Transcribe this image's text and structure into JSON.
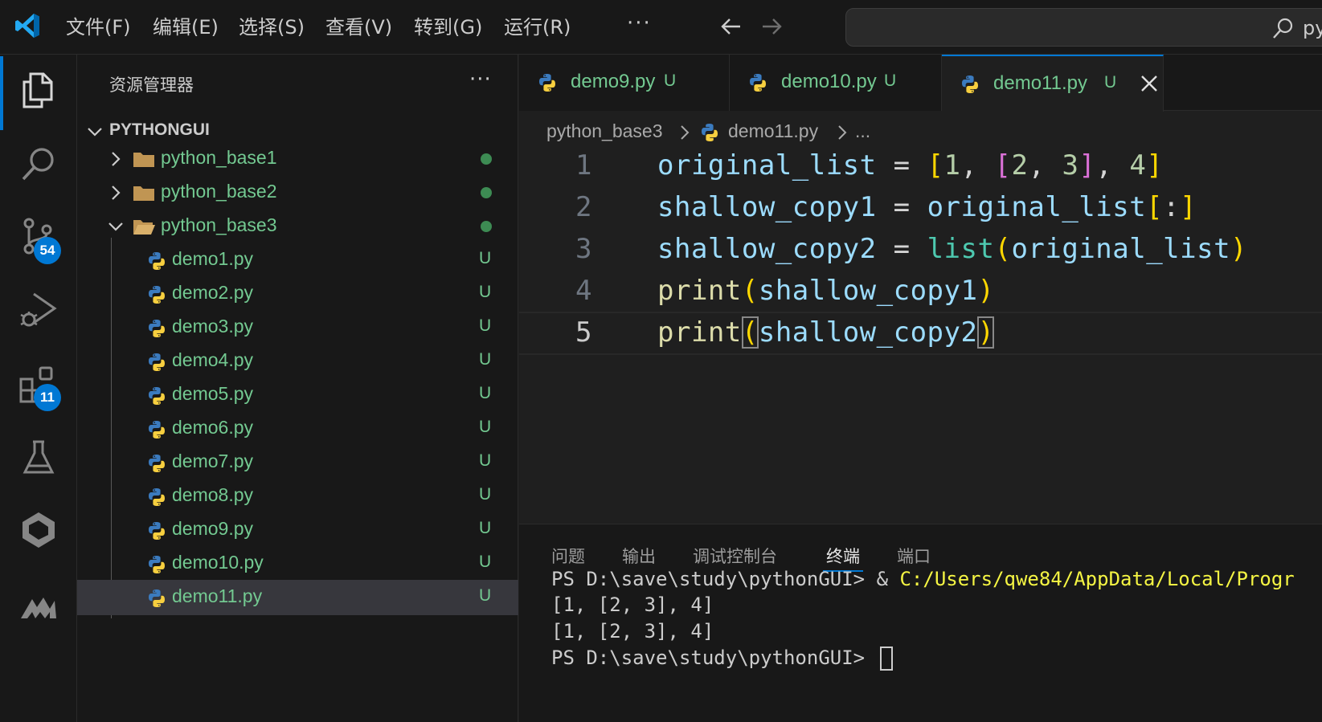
{
  "menu": {
    "items": [
      "文件(F)",
      "编辑(E)",
      "选择(S)",
      "查看(V)",
      "转到(G)",
      "运行(R)"
    ],
    "more": "···"
  },
  "search": {
    "text": "py"
  },
  "activity": {
    "scm_badge": "54",
    "extensions_badge": "11"
  },
  "sidebar": {
    "title": "资源管理器",
    "more": "···",
    "root": "PYTHONGUI",
    "folders": [
      "python_base1",
      "python_base2",
      "python_base3"
    ],
    "files": [
      {
        "name": "demo1.py",
        "status": "U"
      },
      {
        "name": "demo2.py",
        "status": "U"
      },
      {
        "name": "demo3.py",
        "status": "U"
      },
      {
        "name": "demo4.py",
        "status": "U"
      },
      {
        "name": "demo5.py",
        "status": "U"
      },
      {
        "name": "demo6.py",
        "status": "U"
      },
      {
        "name": "demo7.py",
        "status": "U"
      },
      {
        "name": "demo8.py",
        "status": "U"
      },
      {
        "name": "demo9.py",
        "status": "U"
      },
      {
        "name": "demo10.py",
        "status": "U"
      },
      {
        "name": "demo11.py",
        "status": "U"
      }
    ]
  },
  "tabs": [
    {
      "label": "demo9.py",
      "status": "U"
    },
    {
      "label": "demo10.py",
      "status": "U"
    },
    {
      "label": "demo11.py",
      "status": "U"
    }
  ],
  "breadcrumb": {
    "folder": "python_base3",
    "file": "demo11.py",
    "more": "..."
  },
  "code": {
    "line_numbers": [
      "1",
      "2",
      "3",
      "4",
      "5"
    ],
    "lines": [
      "original_list = [1, [2, 3], 4]",
      "shallow_copy1 = original_list[:]",
      "shallow_copy2 = list(original_list)",
      "print(shallow_copy1)",
      "print(shallow_copy2)"
    ]
  },
  "panel": {
    "tabs": [
      "问题",
      "输出",
      "调试控制台",
      "终端",
      "端口"
    ],
    "terminal": {
      "prompt1": "PS D:\\save\\study\\pythonGUI> & ",
      "cmd_path": "C:/Users/qwe84/AppData/Local/Progr",
      "out1": "[1, [2, 3], 4]",
      "out2": "[1, [2, 3], 4]",
      "prompt2": "PS D:\\save\\study\\pythonGUI> "
    }
  }
}
